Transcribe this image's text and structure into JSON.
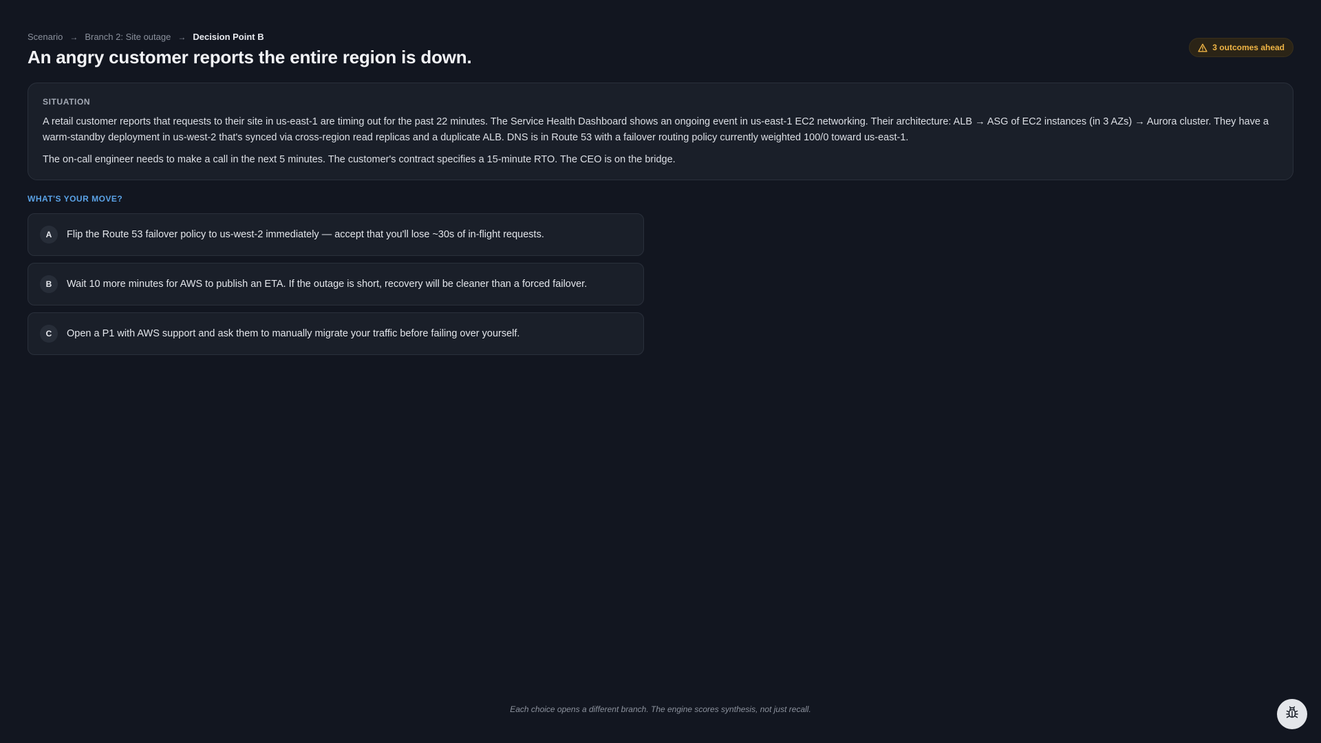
{
  "breadcrumb": {
    "items": [
      "Scenario",
      "Branch 2: Site outage",
      "Decision Point B"
    ],
    "separator": "→"
  },
  "header": {
    "title": "An angry customer reports the entire region is down.",
    "badge": "3 outcomes ahead",
    "badge_icon": "warning-triangle-icon",
    "badge_color": "#f0b545"
  },
  "situation": {
    "label": "SITUATION",
    "paragraphs": [
      "A retail customer reports that requests to their site in us-east-1 are timing out for the past 22 minutes. The Service Health Dashboard shows an ongoing event in us-east-1 EC2 networking. Their architecture: ALB → ASG of EC2 instances (in 3 AZs) → Aurora cluster. They have a warm-standby deployment in us-west-2 that's synced via cross-region read replicas and a duplicate ALB. DNS is in Route 53 with a failover routing policy currently weighted 100/0 toward us-east-1.",
      "The on-call engineer needs to make a call in the next 5 minutes. The customer's contract specifies a 15-minute RTO. The CEO is on the bridge."
    ]
  },
  "moves": {
    "label": "WHAT'S YOUR MOVE?",
    "label_color": "#5aa2e6",
    "choices": [
      {
        "letter": "A",
        "text": "Flip the Route 53 failover policy to us-west-2 immediately — accept that you'll lose ~30s of in-flight requests."
      },
      {
        "letter": "B",
        "text": "Wait 10 more minutes for AWS to publish an ETA. If the outage is short, recovery will be cleaner than a forced failover."
      },
      {
        "letter": "C",
        "text": "Open a P1 with AWS support and ask them to manually migrate your traffic before failing over yourself."
      }
    ]
  },
  "footer": {
    "note": "Each choice opens a different branch. The engine scores synthesis, not just recall."
  },
  "floating_button": {
    "icon": "bug-icon"
  }
}
